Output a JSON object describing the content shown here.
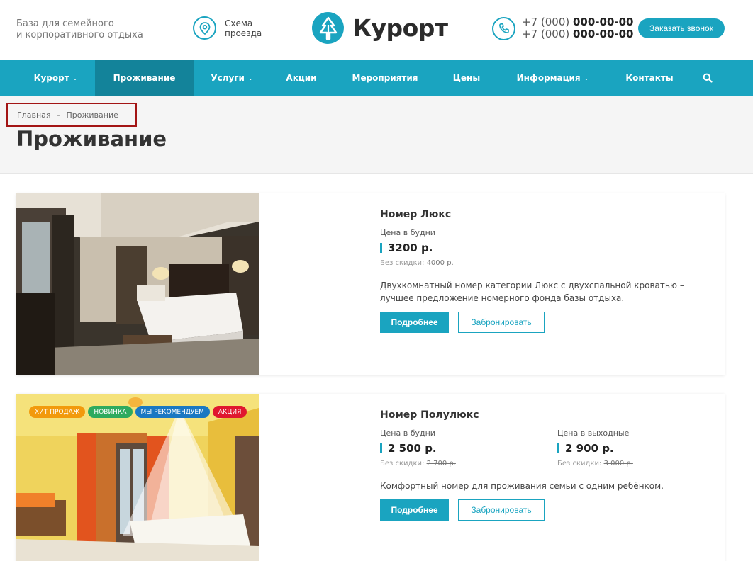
{
  "header": {
    "tagline_line1": "База для семейного",
    "tagline_line2": "и корпоративного отдыха",
    "route_line1": "Схема",
    "route_line2": "проезда",
    "logo_text": "Курорт",
    "phones": [
      {
        "code": "+7 (000) ",
        "number": "000-00-00"
      },
      {
        "code": "+7 (000) ",
        "number": "000-00-00"
      }
    ],
    "call_button": "Заказать звонок"
  },
  "nav": {
    "items": [
      {
        "label": "Курорт",
        "dropdown": true
      },
      {
        "label": "Проживание",
        "active": true
      },
      {
        "label": "Услуги",
        "dropdown": true
      },
      {
        "label": "Акции"
      },
      {
        "label": "Мероприятия"
      },
      {
        "label": "Цены"
      },
      {
        "label": "Информация",
        "dropdown": true
      },
      {
        "label": "Контакты"
      }
    ],
    "chevron": "⌄",
    "search_icon": "search-icon"
  },
  "breadcrumb": {
    "home": "Главная",
    "separator": "-",
    "current": "Проживание"
  },
  "page_title": "Проживание",
  "rooms": [
    {
      "name": "Номер Люкс",
      "weekday_label": "Цена в будни",
      "weekday_price": "3200 р.",
      "no_discount_label": "Без скидки:",
      "weekday_old_price": "4000 р.",
      "description": "Двухкомнатный номер категории Люкс с двухспальной кроватью – лучшее предложение номерного фонда базы отдыха.",
      "more_button": "Подробнее",
      "book_button": "Забронировать"
    },
    {
      "name": "Номер Полулюкс",
      "weekday_label": "Цена в будни",
      "weekday_price": "2 500 р.",
      "no_discount_label": "Без скидки:",
      "weekday_old_price": "2 700 р.",
      "weekend_label": "Цена в выходные",
      "weekend_price": "2 900 р.",
      "weekend_old_price": "3 000 р.",
      "description": "Комфортный номер для проживания семьи с одним ребёнком.",
      "more_button": "Подробнее",
      "book_button": "Забронировать",
      "badges": [
        {
          "label": "ХИТ ПРОДАЖ",
          "color": "#f29a0c"
        },
        {
          "label": "НОВИНКА",
          "color": "#2eaa5f"
        },
        {
          "label": "МЫ РЕКОМЕНДУЕМ",
          "color": "#1a78c2"
        },
        {
          "label": "АКЦИЯ",
          "color": "#e0172f"
        }
      ]
    }
  ],
  "colors": {
    "accent": "#1aa4c0",
    "nav_active": "#13839a"
  }
}
